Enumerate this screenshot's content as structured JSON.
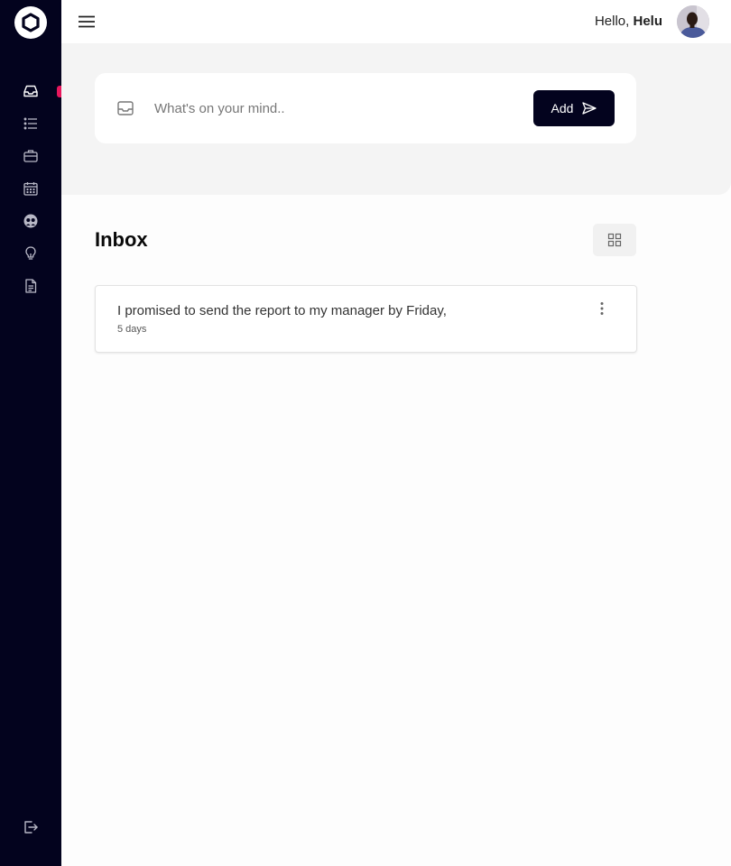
{
  "sidebar": {
    "logo": "hexagon-logo",
    "items": [
      {
        "name": "inbox",
        "icon": "inbox-icon",
        "active": true
      },
      {
        "name": "list",
        "icon": "list-icon",
        "active": false
      },
      {
        "name": "projects",
        "icon": "briefcase-icon",
        "active": false
      },
      {
        "name": "calendar",
        "icon": "calendar-icon",
        "active": false
      },
      {
        "name": "people",
        "icon": "people-icon",
        "active": false
      },
      {
        "name": "ideas",
        "icon": "lightbulb-icon",
        "active": false
      },
      {
        "name": "documents",
        "icon": "document-icon",
        "active": false
      }
    ],
    "logout_icon": "logout-icon",
    "accent_color": "#e8175d",
    "background_color": "#03031e"
  },
  "header": {
    "menu_icon": "hamburger-icon",
    "greeting_prefix": "Hello,",
    "user_name": "Helu"
  },
  "compose": {
    "icon": "inbox-tray-icon",
    "placeholder": "What's on your mind..",
    "value": "",
    "add_label": "Add",
    "add_icon": "send-icon"
  },
  "inbox": {
    "title": "Inbox",
    "view_toggle_icon": "grid-view-icon",
    "items": [
      {
        "text": "I promised to send the report to my manager by Friday,",
        "time": "5 days"
      }
    ]
  }
}
